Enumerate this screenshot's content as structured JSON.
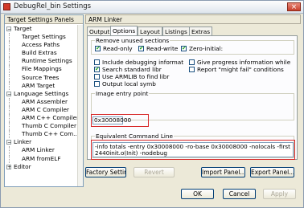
{
  "window": {
    "title": "DebugRel_bin Settings",
    "close_glyph": "×"
  },
  "left_panel": {
    "header": "Target Settings Panels",
    "items": [
      {
        "label": "Target",
        "expander": "−"
      },
      {
        "label": "Target Settings"
      },
      {
        "label": "Access Paths"
      },
      {
        "label": "Build Extras"
      },
      {
        "label": "Runtime Settings"
      },
      {
        "label": "File Mappings"
      },
      {
        "label": "Source Trees"
      },
      {
        "label": "ARM Target"
      },
      {
        "label": "Language Settings",
        "expander": "−"
      },
      {
        "label": "ARM Assembler"
      },
      {
        "label": "ARM C Compiler"
      },
      {
        "label": "ARM C++ Compiler"
      },
      {
        "label": "Thumb C Compiler"
      },
      {
        "label": "Thumb C++ Com..."
      },
      {
        "label": "Linker",
        "expander": "−"
      },
      {
        "label": "ARM Linker"
      },
      {
        "label": "ARM fromELF"
      },
      {
        "label": "Editor",
        "expander": "+"
      }
    ]
  },
  "dialog": {
    "header": "ARM Linker",
    "tabs": [
      "Output",
      "Options",
      "Layout",
      "Listings",
      "Extras"
    ],
    "active_tab": "Options",
    "unused_sections": {
      "title": "Remove unused sections",
      "options": [
        {
          "label": "Read-only",
          "checked": true
        },
        {
          "label": "Read-write",
          "checked": true
        },
        {
          "label": "Zero-initial:",
          "checked": true
        }
      ]
    },
    "options_left": [
      {
        "label": "Include debugging informat",
        "checked": false
      },
      {
        "label": "Search standard libr",
        "checked": true
      },
      {
        "label": "Use ARMLIB to find libr",
        "checked": false
      },
      {
        "label": "Output local symb",
        "checked": false
      }
    ],
    "options_right": [
      {
        "label": "Give progress information while",
        "checked": false
      },
      {
        "label": "Report \"might fail\" conditions",
        "checked": false
      }
    ],
    "image_entry": {
      "title": "Image entry point",
      "value": "0x30008000"
    },
    "cmd_line": {
      "title": "Equivalent Command Line",
      "value": "-info totals -entry 0x30008000 -ro-base 0x30008000 -nolocals -first 2440init.o(Init) -nodebug"
    },
    "buttons": {
      "factory": "Factory Settings",
      "revert": "Revert",
      "import": "Import Panel...",
      "export": "Export Panel..."
    }
  },
  "footer": {
    "ok": "OK",
    "cancel": "Cancel",
    "apply": "Apply"
  },
  "colors": {
    "highlight_border": "#d72828",
    "check_mark": "#21a121"
  }
}
